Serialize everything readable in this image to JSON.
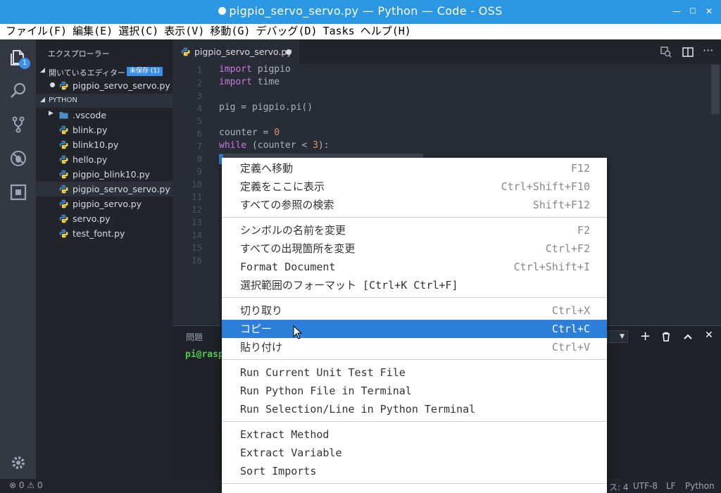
{
  "window": {
    "title": "pigpio_servo_servo.py — Python — Code - OSS"
  },
  "menubar": [
    "ファイル(F)",
    "編集(E)",
    "選択(C)",
    "表示(V)",
    "移動(G)",
    "デバッグ(D)",
    "Tasks",
    "ヘルプ(H)"
  ],
  "activity": {
    "badge": "1"
  },
  "sidebar": {
    "header": "エクスプローラー",
    "open_editors": {
      "label": "開いているエディター",
      "badge": "未保存 (1)",
      "file": "pigpio_servo_servo.py"
    },
    "folder": "PYTHON",
    "items": [
      {
        "label": ".vscode",
        "type": "folder"
      },
      {
        "label": "blink.py"
      },
      {
        "label": "blink10.py"
      },
      {
        "label": "hello.py"
      },
      {
        "label": "pigpio_blink10.py"
      },
      {
        "label": "pigpio_servo_servo.py",
        "selected": true
      },
      {
        "label": "pigpio_servo.py"
      },
      {
        "label": "servo.py"
      },
      {
        "label": "test_font.py"
      }
    ]
  },
  "tab": {
    "label": "pigpio_servo_servo.py"
  },
  "editor": {
    "line_numbers": [
      "1",
      "2",
      "3",
      "4",
      "5",
      "6",
      "7",
      "8",
      "9",
      "10",
      "11",
      "12",
      "13",
      "14",
      "15",
      "16"
    ],
    "code": [
      {
        "kw": "import",
        "rest": " pigpio"
      },
      {
        "kw": "import",
        "rest": " time"
      },
      {
        "kw": "",
        "rest": ""
      },
      {
        "kw": "",
        "rest": "pig = pigpio.pi()"
      },
      {
        "kw": "",
        "rest": ""
      },
      {
        "kw": "",
        "rest": "counter = ",
        "num": "0"
      },
      {
        "kw": "while",
        "rest": " (counter < ",
        "num": "3",
        "tail": "):"
      }
    ]
  },
  "panel": {
    "tab": "問題",
    "terminal_prompt": "pi@rasp"
  },
  "statusbar": {
    "errors": "0",
    "warnings": "0",
    "spaces": "ス: 4",
    "encoding": "UTF-8",
    "eol": "LF",
    "language": "Python"
  },
  "context_menu": {
    "groups": [
      [
        {
          "label": "定義へ移動",
          "key": "F12"
        },
        {
          "label": "定義をここに表示",
          "key": "Ctrl+Shift+F10"
        },
        {
          "label": "すべての参照の検索",
          "key": "Shift+F12"
        }
      ],
      [
        {
          "label": "シンボルの名前を変更",
          "key": "F2"
        },
        {
          "label": "すべての出現箇所を変更",
          "key": "Ctrl+F2"
        },
        {
          "label": "Format Document",
          "key": "Ctrl+Shift+I"
        },
        {
          "label": "選択範囲のフォーマット [Ctrl+K Ctrl+F]",
          "key": ""
        }
      ],
      [
        {
          "label": "切り取り",
          "key": "Ctrl+X"
        },
        {
          "label": "コピー",
          "key": "Ctrl+C",
          "highlighted": true
        },
        {
          "label": "貼り付け",
          "key": "Ctrl+V"
        }
      ],
      [
        {
          "label": "Run Current Unit Test File",
          "key": ""
        },
        {
          "label": "Run Python File in Terminal",
          "key": ""
        },
        {
          "label": "Run Selection/Line in Python Terminal",
          "key": ""
        }
      ],
      [
        {
          "label": "Extract Method",
          "key": ""
        },
        {
          "label": "Extract Variable",
          "key": ""
        },
        {
          "label": "Sort Imports",
          "key": ""
        }
      ]
    ]
  }
}
